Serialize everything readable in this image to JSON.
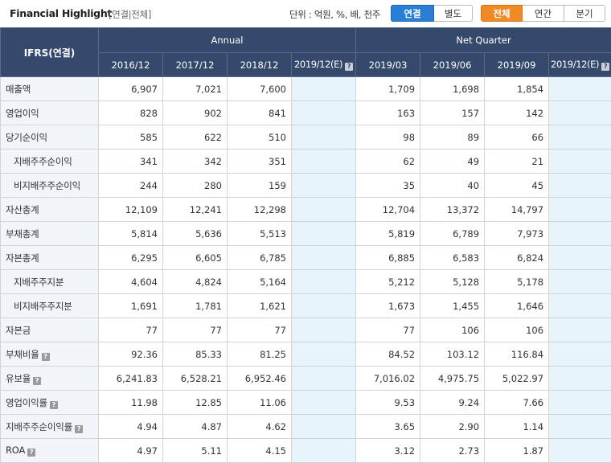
{
  "header": {
    "title": "Financial Highlight",
    "subtitle": "[연결|전체]",
    "unit": "단위 : 억원, %, 배, 천주",
    "consol_buttons": [
      {
        "label": "연결",
        "active": true
      },
      {
        "label": "별도",
        "active": false
      }
    ],
    "period_buttons": [
      {
        "label": "전체",
        "active": true
      },
      {
        "label": "연간",
        "active": false
      },
      {
        "label": "분기",
        "active": false
      }
    ]
  },
  "table": {
    "corner": "IFRS(연결)",
    "group_annual": "Annual",
    "group_quarter": "Net Quarter",
    "columns": [
      "2016/12",
      "2017/12",
      "2018/12",
      "2019/12(E)",
      "2019/03",
      "2019/06",
      "2019/09",
      "2019/12(E)"
    ],
    "rows": [
      {
        "label": "매출액",
        "sub": false,
        "help": false,
        "values": [
          "6,907",
          "7,021",
          "7,600",
          "",
          "1,709",
          "1,698",
          "1,854",
          ""
        ]
      },
      {
        "label": "영업이익",
        "sub": false,
        "help": false,
        "values": [
          "828",
          "902",
          "841",
          "",
          "163",
          "157",
          "142",
          ""
        ]
      },
      {
        "label": "당기순이익",
        "sub": false,
        "help": false,
        "values": [
          "585",
          "622",
          "510",
          "",
          "98",
          "89",
          "66",
          ""
        ]
      },
      {
        "label": "지배주주순이익",
        "sub": true,
        "help": false,
        "values": [
          "341",
          "342",
          "351",
          "",
          "62",
          "49",
          "21",
          ""
        ]
      },
      {
        "label": "비지배주주순이익",
        "sub": true,
        "help": false,
        "values": [
          "244",
          "280",
          "159",
          "",
          "35",
          "40",
          "45",
          ""
        ]
      },
      {
        "label": "자산총계",
        "sub": false,
        "help": false,
        "values": [
          "12,109",
          "12,241",
          "12,298",
          "",
          "12,704",
          "13,372",
          "14,797",
          ""
        ]
      },
      {
        "label": "부채총계",
        "sub": false,
        "help": false,
        "values": [
          "5,814",
          "5,636",
          "5,513",
          "",
          "5,819",
          "6,789",
          "7,973",
          ""
        ]
      },
      {
        "label": "자본총계",
        "sub": false,
        "help": false,
        "values": [
          "6,295",
          "6,605",
          "6,785",
          "",
          "6,885",
          "6,583",
          "6,824",
          ""
        ]
      },
      {
        "label": "지배주주지분",
        "sub": true,
        "help": false,
        "values": [
          "4,604",
          "4,824",
          "5,164",
          "",
          "5,212",
          "5,128",
          "5,178",
          ""
        ]
      },
      {
        "label": "비지배주주지분",
        "sub": true,
        "help": false,
        "values": [
          "1,691",
          "1,781",
          "1,621",
          "",
          "1,673",
          "1,455",
          "1,646",
          ""
        ]
      },
      {
        "label": "자본금",
        "sub": false,
        "help": false,
        "values": [
          "77",
          "77",
          "77",
          "",
          "77",
          "106",
          "106",
          ""
        ]
      },
      {
        "label": "부채비율",
        "sub": false,
        "help": true,
        "values": [
          "92.36",
          "85.33",
          "81.25",
          "",
          "84.52",
          "103.12",
          "116.84",
          ""
        ]
      },
      {
        "label": "유보율",
        "sub": false,
        "help": true,
        "values": [
          "6,241.83",
          "6,528.21",
          "6,952.46",
          "",
          "7,016.02",
          "4,975.75",
          "5,022.97",
          ""
        ]
      },
      {
        "label": "영업이익률",
        "sub": false,
        "help": true,
        "values": [
          "11.98",
          "12.85",
          "11.06",
          "",
          "9.53",
          "9.24",
          "7.66",
          ""
        ]
      },
      {
        "label": "지배주주순이익률",
        "sub": false,
        "help": true,
        "values": [
          "4.94",
          "4.87",
          "4.62",
          "",
          "3.65",
          "2.90",
          "1.14",
          ""
        ]
      },
      {
        "label": "ROA",
        "sub": false,
        "help": true,
        "values": [
          "4.97",
          "5.11",
          "4.15",
          "",
          "3.12",
          "2.73",
          "1.87",
          ""
        ]
      }
    ]
  },
  "icons": {
    "help": "question-mark-icon",
    "help_glyph": "?"
  },
  "colors": {
    "header_bg": "#34496b",
    "estimate_bg": "#e8f4fb",
    "label_bg": "#f1f4f9",
    "consol_active": "#2a7fd4",
    "period_active": "#f08a24"
  }
}
